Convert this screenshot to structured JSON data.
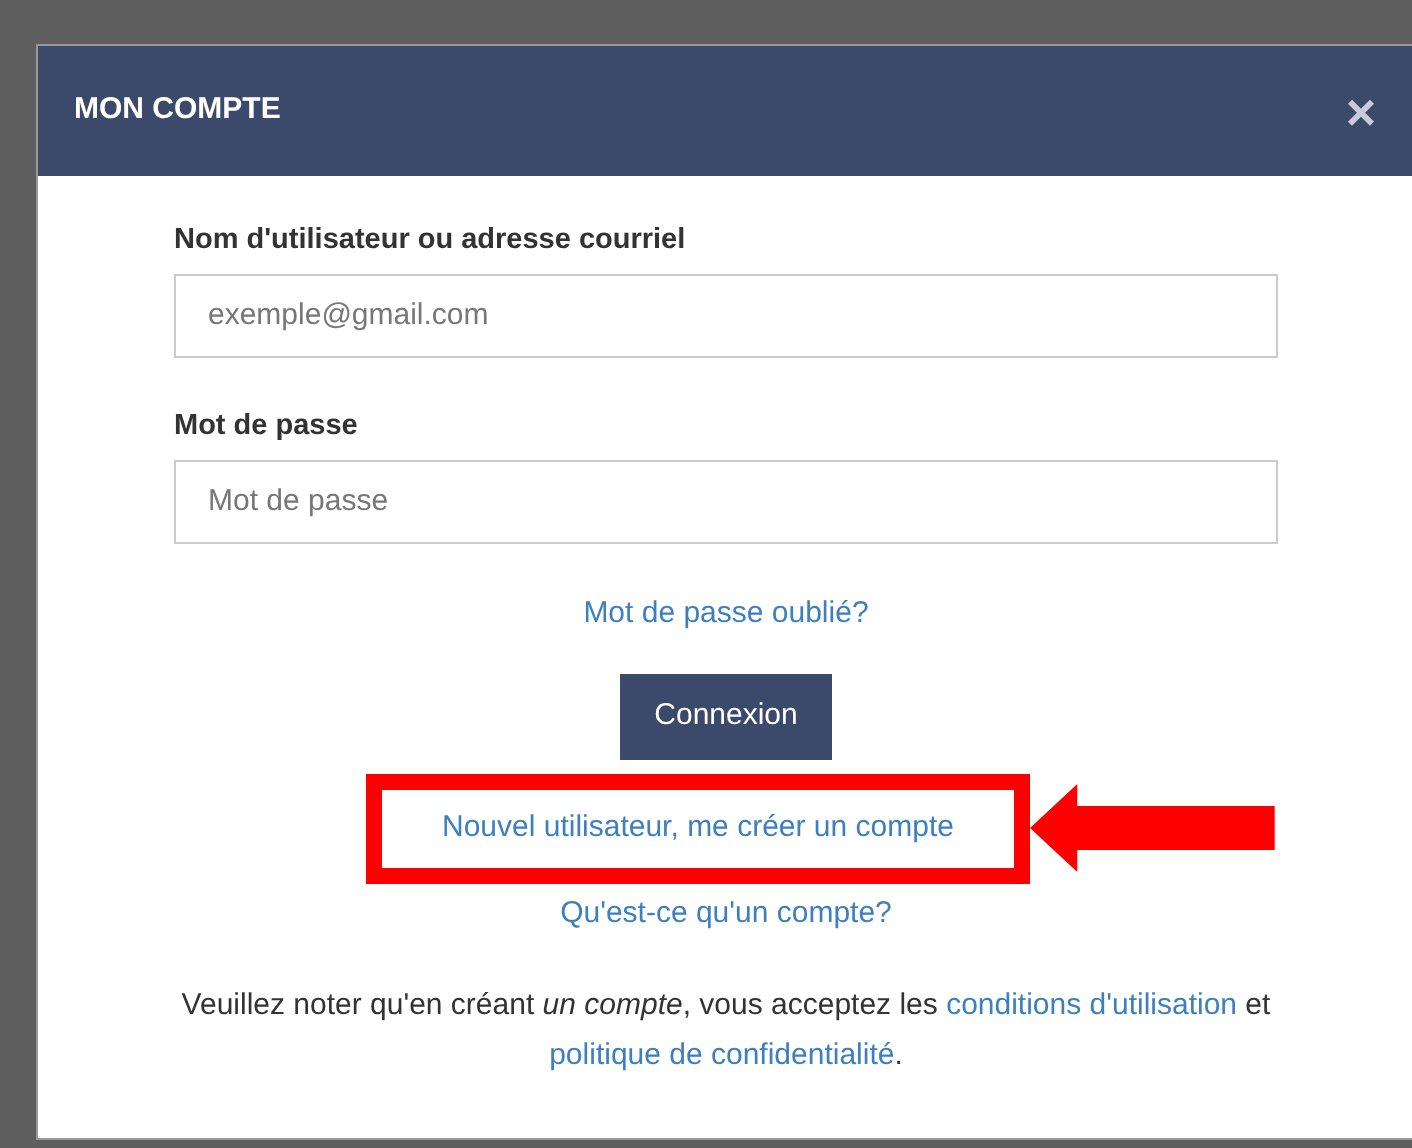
{
  "modal": {
    "title": "MON COMPTE",
    "close": "×"
  },
  "fields": [
    {
      "label": "Nom d'utilisateur ou adresse courriel",
      "placeholder": "exemple@gmail.com"
    },
    {
      "label": "Mot de passe",
      "placeholder": "Mot de passe"
    }
  ],
  "forgot_link": "Mot de passe oublié?",
  "submit_button": "Connexion",
  "create_account_link": {
    "text": "Nouvel utilisateur, me créer un compte",
    "highlighted": true
  },
  "about_link": "Qu'est-ce qu'un compte?",
  "note": {
    "text": "Veuillez noter qu'en créant *un compte*, vous acceptez les ",
    "terms_link": "conditions d'utilisation",
    "joiner": " et ",
    "privacy_link": "politique de confidentialité",
    "end": "."
  }
}
